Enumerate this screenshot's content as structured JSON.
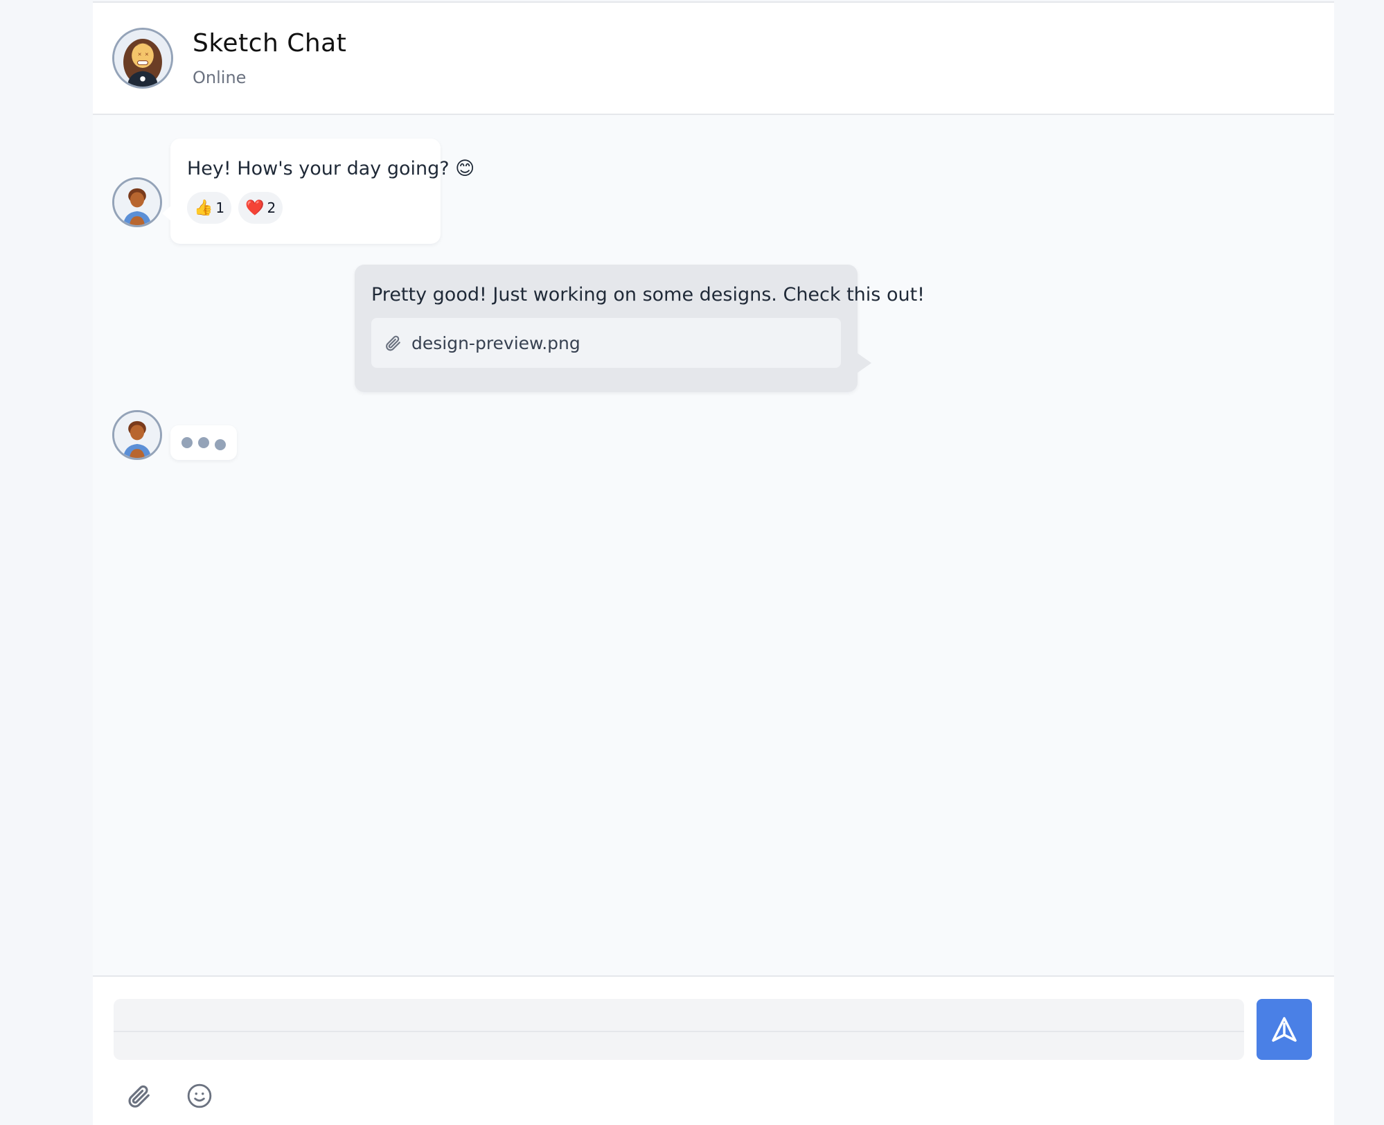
{
  "header": {
    "title": "Sketch Chat",
    "status": "Online",
    "avatar_icon": "woman-avatar-icon"
  },
  "messages": {
    "incoming_1": {
      "avatar_icon": "girl-avatar-icon",
      "text": "Hey! How's your day going? 😊",
      "reactions": [
        {
          "emoji": "👍",
          "count": "1"
        },
        {
          "emoji": "❤️",
          "count": "2"
        }
      ]
    },
    "outgoing_1": {
      "text": "Pretty good! Just working on some designs. Check this out!",
      "attachment": {
        "icon": "paperclip-icon",
        "filename": "design-preview.png"
      }
    },
    "typing": {
      "avatar_icon": "girl-avatar-icon",
      "indicator": "typing-dots"
    }
  },
  "composer": {
    "input_value": "",
    "send_icon": "send-icon",
    "tools": [
      "paperclip-icon",
      "smiley-icon"
    ]
  },
  "colors": {
    "accent": "#4a80e6",
    "background": "#f8fafc",
    "outgoing_bubble": "#e5e7eb",
    "muted_text": "#6b7280"
  }
}
